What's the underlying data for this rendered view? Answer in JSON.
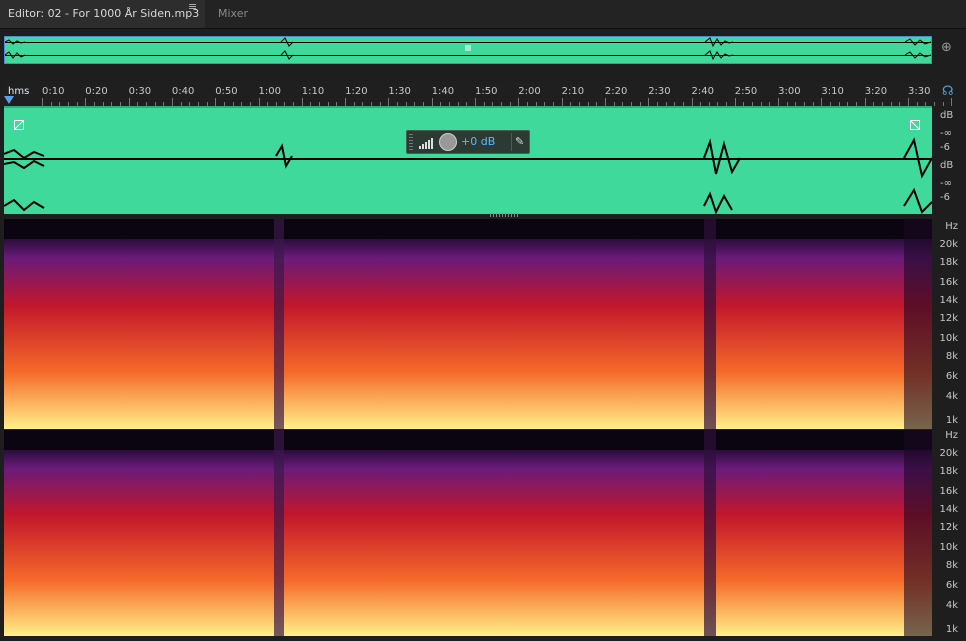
{
  "tabs": {
    "editor_label": "Editor: 02 - For 1000 År Siden.mp3",
    "menu_icon": "≡",
    "mixer_label": "Mixer"
  },
  "ruler": {
    "unit_label": "hms",
    "labels": [
      "0:10",
      "0:20",
      "0:30",
      "0:40",
      "0:50",
      "1:00",
      "1:10",
      "1:20",
      "1:30",
      "1:40",
      "1:50",
      "2:00",
      "2:10",
      "2:20",
      "2:30",
      "2:40",
      "2:50",
      "3:00",
      "3:10",
      "3:20",
      "3:30"
    ]
  },
  "hud": {
    "gain": "+0 dB"
  },
  "db_scale": {
    "unit": "dB",
    "inf": "-∞",
    "minus6": "-6"
  },
  "hz_scale": {
    "unit": "Hz",
    "labels": [
      "20k",
      "18k",
      "16k",
      "14k",
      "12k",
      "10k",
      "8k",
      "6k",
      "4k",
      "1k"
    ]
  },
  "colors": {
    "waveform": "#3fd99c",
    "accent": "#5aa0e6",
    "background": "#1e1e1e"
  }
}
